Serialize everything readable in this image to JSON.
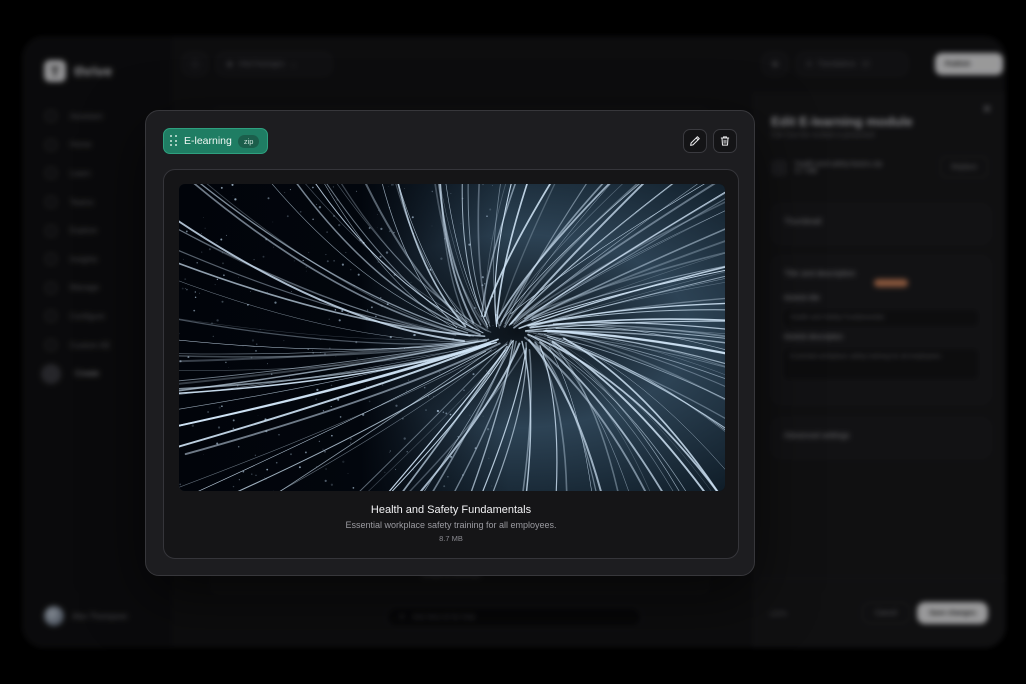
{
  "background_app": {
    "brand": {
      "logo_letter": "T",
      "name": "thrive"
    },
    "sidebar": {
      "items": [
        {
          "label": "Assistant"
        },
        {
          "label": "Home"
        },
        {
          "label": "Learn"
        },
        {
          "label": "Teams"
        },
        {
          "label": "Explore"
        },
        {
          "label": "Insights"
        },
        {
          "label": "Manage"
        },
        {
          "label": "Configure"
        },
        {
          "label": "Custom AB"
        },
        {
          "label": "Create"
        }
      ],
      "user_name": "Alex Thompson"
    },
    "topbar": {
      "breadcrumb": "Vital Packages",
      "translations": "Translations",
      "translations_count": "12",
      "publish": "Publish"
    },
    "main_footer_text": "Create & Generate",
    "chat_placeholder": "Ask Hero AI for help",
    "edit_panel": {
      "title": "Edit E-learning module",
      "subtitle": "Edit how the module is presented",
      "file_name": "health-and-safety-basics.zip",
      "file_size": "8.7 MB",
      "replace": "Replace",
      "sections": {
        "thumbnail": "Thumbnail",
        "title_description": "Title and description",
        "module_title_label": "Module title",
        "module_title_value": "Health and Safety Fundamentals",
        "module_desc_label": "Module description",
        "module_desc_value": "Essential workplace safety training for all employees.",
        "advanced": "Advanced settings"
      },
      "zoom": "100%",
      "cancel": "Cancel",
      "save": "Save changes"
    }
  },
  "modal": {
    "tag_label": "E-learning",
    "tag_badge": "zip",
    "module_title": "Health and Safety Fundamentals",
    "module_description": "Essential workplace safety training for all employees.",
    "file_size": "8.7 MB",
    "icons": [
      "drag-handle-icon",
      "pencil-icon",
      "trash-icon"
    ]
  },
  "colors": {
    "accent_green": "#1f7d63",
    "modal_bg": "#1d1d20",
    "streak_color": "#cfe3f5"
  }
}
